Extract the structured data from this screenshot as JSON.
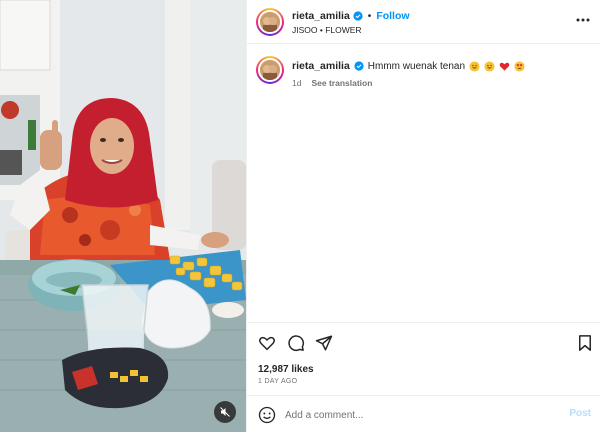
{
  "post": {
    "username": "rieta_amilia",
    "follow_label": "Follow",
    "separator": "•",
    "audio": "JISOO • FLOWER",
    "more_icon": "more-horizontal-icon"
  },
  "caption": {
    "username": "rieta_amilia",
    "text": "Hmmm wuenak tenan",
    "emojis": [
      "grinning-face-emoji",
      "grinning-face-emoji",
      "red-heart-emoji",
      "heart-eyes-emoji"
    ],
    "time": "1d",
    "see_translation": "See translation"
  },
  "actions": {
    "like_icon": "heart-icon",
    "comment_icon": "comment-icon",
    "share_icon": "send-icon",
    "save_icon": "bookmark-icon"
  },
  "likes": "12,987 likes",
  "date": "1 DAY AGO",
  "comment_box": {
    "placeholder": "Add a comment...",
    "post_label": "Post"
  },
  "media": {
    "type": "video",
    "mute_icon": "muted-speaker-icon"
  },
  "colors": {
    "link_blue": "#0095f6",
    "post_disabled": "#b2dffc",
    "verified_blue": "#0095f6",
    "text_primary": "#262626",
    "text_secondary": "#737373"
  }
}
